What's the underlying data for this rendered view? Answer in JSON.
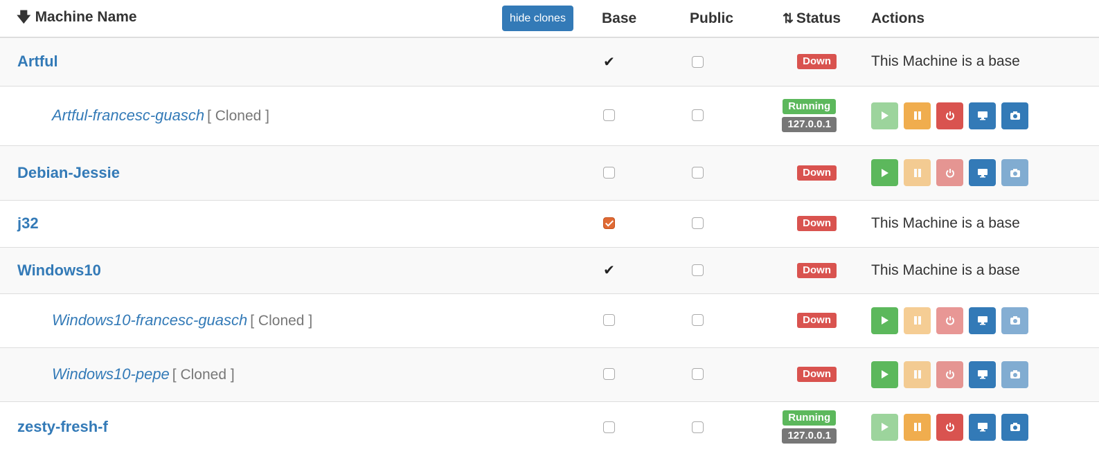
{
  "header": {
    "sort_icon": "arrow-down-icon",
    "machine_name": "Machine Name",
    "hide_clones_label": "hide clones",
    "base": "Base",
    "public": "Public",
    "status_sort_icon": "sort-arrows-icon",
    "status": "Status",
    "actions": "Actions"
  },
  "rows": [
    {
      "name": "Artful",
      "clone": false,
      "cloned_tag": "",
      "base": "tick",
      "public": false,
      "status": "Down",
      "ip": "",
      "actions_text": "This Machine is a base",
      "buttons": []
    },
    {
      "name": "Artful-francesc-guasch",
      "clone": true,
      "cloned_tag": "[ Cloned ]",
      "base": "unchecked",
      "public": false,
      "status": "Running",
      "ip": "127.0.0.1",
      "actions_text": "",
      "buttons": [
        "start-disabled",
        "pause",
        "shutdown",
        "view",
        "screenshot"
      ]
    },
    {
      "name": "Debian-Jessie",
      "clone": false,
      "cloned_tag": "",
      "base": "unchecked",
      "public": false,
      "status": "Down",
      "ip": "",
      "actions_text": "",
      "buttons": [
        "start",
        "pause-disabled",
        "shutdown-disabled",
        "view",
        "screenshot-disabled"
      ]
    },
    {
      "name": "j32",
      "clone": false,
      "cloned_tag": "",
      "base": "checked",
      "public": false,
      "status": "Down",
      "ip": "",
      "actions_text": "This Machine is a base",
      "buttons": []
    },
    {
      "name": "Windows10",
      "clone": false,
      "cloned_tag": "",
      "base": "tick",
      "public": false,
      "status": "Down",
      "ip": "",
      "actions_text": "This Machine is a base",
      "buttons": []
    },
    {
      "name": "Windows10-francesc-guasch",
      "clone": true,
      "cloned_tag": "[ Cloned ]",
      "base": "unchecked",
      "public": false,
      "status": "Down",
      "ip": "",
      "actions_text": "",
      "buttons": [
        "start",
        "pause-disabled",
        "shutdown-disabled",
        "view",
        "screenshot-disabled"
      ]
    },
    {
      "name": "Windows10-pepe",
      "clone": true,
      "cloned_tag": "[ Cloned ]",
      "base": "unchecked",
      "public": false,
      "status": "Down",
      "ip": "",
      "actions_text": "",
      "buttons": [
        "start",
        "pause-disabled",
        "shutdown-disabled",
        "view",
        "screenshot-disabled"
      ]
    },
    {
      "name": "zesty-fresh-f",
      "clone": false,
      "cloned_tag": "",
      "base": "unchecked",
      "public": false,
      "status": "Running",
      "ip": "127.0.0.1",
      "actions_text": "",
      "buttons": [
        "start-disabled",
        "pause",
        "shutdown",
        "view",
        "screenshot"
      ]
    }
  ],
  "colors": {
    "link": "#337ab7",
    "down": "#d9534f",
    "running": "#5cb85c",
    "ip": "#777777",
    "pause": "#f0ad4e",
    "checked": "#e06a34"
  }
}
